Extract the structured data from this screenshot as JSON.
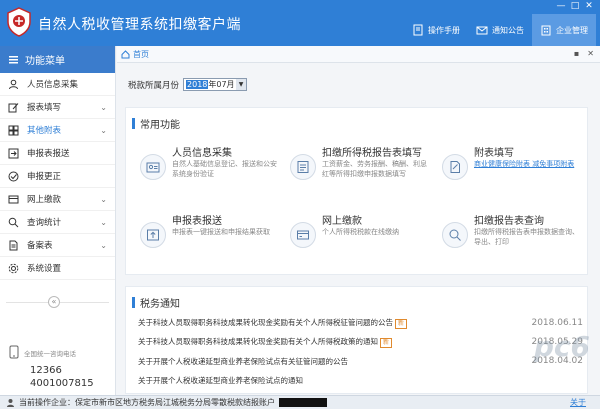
{
  "app": {
    "title": "自然人税收管理系统扣缴客户端",
    "window_controls": [
      "—",
      "□",
      "✕"
    ],
    "toolbar": [
      {
        "label": "操作手册",
        "icon": "manual-icon",
        "active": false
      },
      {
        "label": "通知公告",
        "icon": "mail-icon",
        "active": false
      },
      {
        "label": "企业管理",
        "icon": "building-icon",
        "active": true
      }
    ]
  },
  "sidebar": {
    "header": "功能菜单",
    "items": [
      {
        "label": "人员信息采集",
        "icon": "person-icon",
        "chevron": ""
      },
      {
        "label": "报表填写",
        "icon": "edit-icon",
        "chevron": "⌄"
      },
      {
        "label": "其他附表",
        "icon": "grid-icon",
        "chevron": "⌄",
        "active": true
      },
      {
        "label": "申报表报送",
        "icon": "send-icon",
        "chevron": ""
      },
      {
        "label": "申报更正",
        "icon": "correct-icon",
        "chevron": ""
      },
      {
        "label": "网上缴款",
        "icon": "card-icon",
        "chevron": "⌄"
      },
      {
        "label": "查询统计",
        "icon": "search-icon",
        "chevron": "⌄"
      },
      {
        "label": "备案表",
        "icon": "doc-icon",
        "chevron": "⌄"
      },
      {
        "label": "系统设置",
        "icon": "gear-icon",
        "chevron": ""
      }
    ],
    "collapse": "«",
    "hotline": {
      "title": "全国统一咨询电话",
      "numbers": [
        "12366",
        "4001007815"
      ]
    }
  },
  "tabs": {
    "home": "首页",
    "controls": [
      "▪",
      "✕"
    ]
  },
  "period": {
    "label": "税款所属月份",
    "value_year": "2018",
    "value_month": "年07月"
  },
  "common": {
    "title": "常用功能",
    "functions": [
      {
        "name": "人员信息采集",
        "desc": "自然人基础信息登记、报送和公安系统身份验证",
        "icon": "person-card-icon",
        "link": false
      },
      {
        "name": "扣缴所得税报告表填写",
        "desc": "工资薪金、劳务报酬、稿酬、利息红等所得扣缴申报数据填写",
        "icon": "form-icon",
        "link": false
      },
      {
        "name": "附表填写",
        "desc": "商业健康保险附表 减免事项附表",
        "icon": "attach-icon",
        "link": true
      },
      {
        "name": "申报表报送",
        "desc": "申报表一键报送和申报结果获取",
        "icon": "upload-icon",
        "link": false
      },
      {
        "name": "网上缴款",
        "desc": "个人所得税税款在线缴纳",
        "icon": "payment-icon",
        "link": false
      },
      {
        "name": "扣缴报告表查询",
        "desc": "扣缴所得税报告表申报数据查询、导出、打印",
        "icon": "query-icon",
        "link": false
      }
    ]
  },
  "notices": {
    "title": "税务通知",
    "items": [
      {
        "text": "关于科技人员取得职务科技成果转化现金奖励有关个人所得税征管问题的公告",
        "new": true,
        "date": "2018.06.11"
      },
      {
        "text": "关于科技人员取得职务科技成果转化现金奖励有关个人所得税政策的通知",
        "new": true,
        "date": "2018.05.29"
      },
      {
        "text": "关于开展个人税收递延型商业养老保险试点有关征管问题的公告",
        "new": false,
        "date": "2018.04.02"
      },
      {
        "text": "关于开展个人税收递延型商业养老保险试点的通知",
        "new": false,
        "date": ""
      }
    ],
    "new_badge": "新"
  },
  "status": {
    "text": "当前操作企业：保定市新市区地方税务局江城税务分局零散税款结报账户",
    "about": "关于"
  },
  "watermark": "pc6"
}
